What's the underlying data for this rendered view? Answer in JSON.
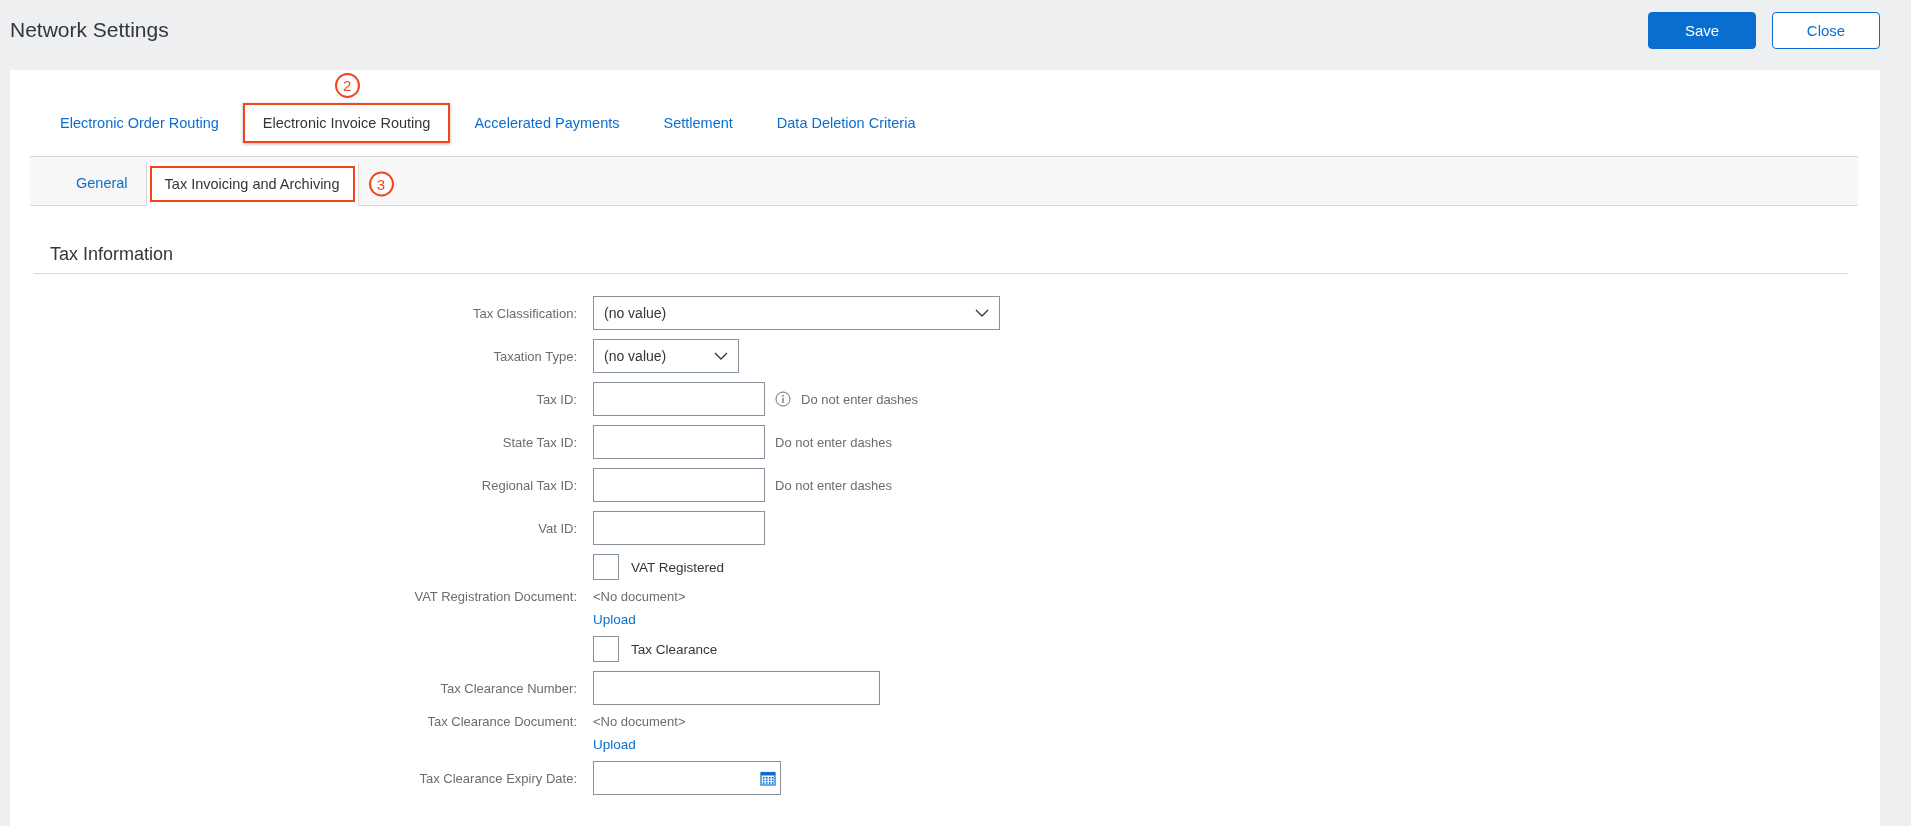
{
  "page": {
    "title": "Network Settings"
  },
  "header_buttons": [
    {
      "label": "Save",
      "kind": "primary"
    },
    {
      "label": "Close",
      "kind": "secondary"
    }
  ],
  "tabs": [
    {
      "label": "Electronic Order Routing",
      "selected": false
    },
    {
      "label": "Electronic Invoice Routing",
      "selected": true,
      "callout": "2"
    },
    {
      "label": "Accelerated Payments",
      "selected": false
    },
    {
      "label": "Settlement",
      "selected": false
    },
    {
      "label": "Data Deletion Criteria",
      "selected": false
    }
  ],
  "subtabs": [
    {
      "label": "General",
      "selected": false
    },
    {
      "label": "Tax Invoicing and Archiving",
      "selected": true,
      "callout": "3"
    }
  ],
  "section": {
    "title": "Tax Information"
  },
  "form": [
    {
      "kind": "select",
      "label": "Tax Classification:",
      "value": "(no value)"
    },
    {
      "kind": "select",
      "label": "Taxation Type:",
      "value": "(no value)"
    },
    {
      "kind": "text",
      "label": "Tax ID:",
      "hint": "Do not enter dashes",
      "info": true
    },
    {
      "kind": "text",
      "label": "State Tax ID:",
      "hint": "Do not enter dashes"
    },
    {
      "kind": "text",
      "label": "Regional Tax ID:",
      "hint": "Do not enter dashes"
    },
    {
      "kind": "text",
      "label": "Vat ID:"
    },
    {
      "kind": "checkbox",
      "label": "VAT Registered",
      "checked": false
    },
    {
      "kind": "document",
      "label": "VAT Registration Document:",
      "value": "<No document>",
      "link": "Upload"
    },
    {
      "kind": "checkbox",
      "label": "Tax Clearance",
      "checked": false
    },
    {
      "kind": "text",
      "label": "Tax Clearance Number:"
    },
    {
      "kind": "document",
      "label": "Tax Clearance Document:",
      "value": "<No document>",
      "link": "Upload"
    },
    {
      "kind": "date",
      "label": "Tax Clearance Expiry Date:"
    }
  ]
}
